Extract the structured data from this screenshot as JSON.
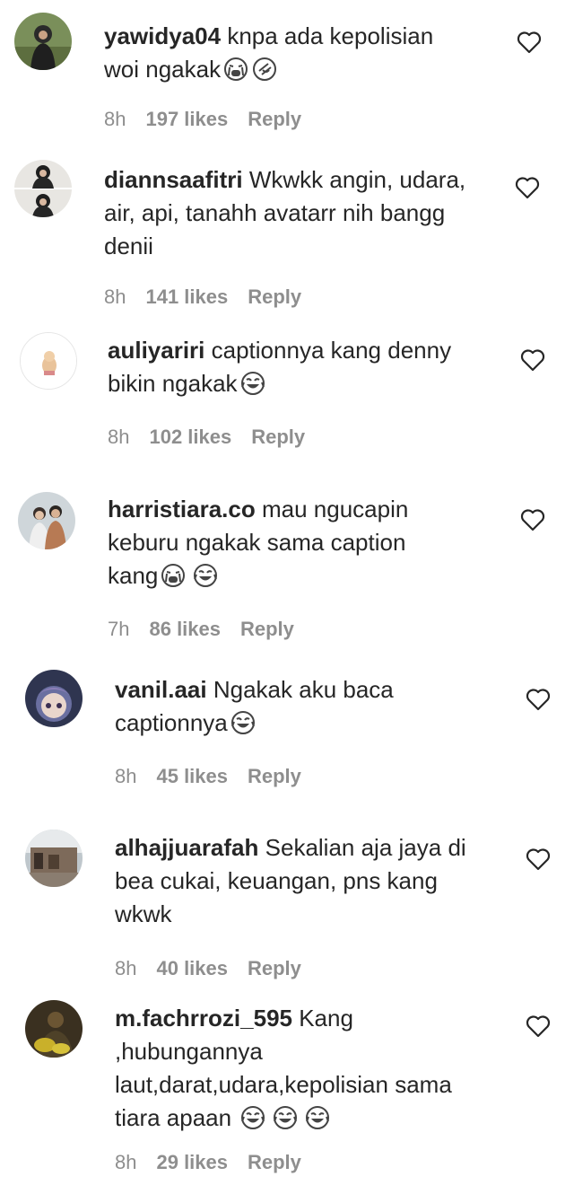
{
  "comments": [
    {
      "username": "yawidya04",
      "text_lines": [
        "knpa ada kepolisian",
        "woi ngakak"
      ],
      "emojis": [
        "loudly-crying-face-icon",
        "rolling-on-floor-laughing-icon"
      ],
      "time": "8h",
      "likes": "197 likes",
      "reply": "Reply"
    },
    {
      "username": "diannsaafitri",
      "text_lines": [
        "Wkwkk angin, udara,",
        "air, api, tanahh avatarr nih bangg",
        "denii"
      ],
      "emojis": [],
      "time": "8h",
      "likes": "141 likes",
      "reply": "Reply"
    },
    {
      "username": "auliyariri",
      "text_lines": [
        "captionnya kang denny",
        "bikin ngakak"
      ],
      "emojis": [
        "tears-of-joy-face-icon"
      ],
      "time": "8h",
      "likes": "102 likes",
      "reply": "Reply"
    },
    {
      "username": "harristiara.co",
      "text_lines": [
        "mau ngucapin",
        "keburu ngakak sama caption",
        "kang"
      ],
      "emojis": [
        "loudly-crying-face-icon",
        "tears-of-joy-face-icon"
      ],
      "time": "7h",
      "likes": "86 likes",
      "reply": "Reply"
    },
    {
      "username": "vanil.aai",
      "text_lines": [
        "Ngakak aku baca",
        "captionnya"
      ],
      "emojis": [
        "tears-of-joy-face-icon"
      ],
      "time": "8h",
      "likes": "45 likes",
      "reply": "Reply"
    },
    {
      "username": "alhajjuarafah",
      "text_lines": [
        "Sekalian aja jaya di",
        "bea cukai, keuangan, pns kang",
        "wkwk"
      ],
      "emojis": [],
      "time": "8h",
      "likes": "40 likes",
      "reply": "Reply"
    },
    {
      "username": "m.fachrrozi_595",
      "text_lines": [
        "Kang",
        ",hubungannya",
        "laut,darat,udara,kepolisian sama",
        "tiara apaan"
      ],
      "emojis": [
        "tears-of-joy-face-icon",
        "tears-of-joy-face-icon",
        "tears-of-joy-face-icon"
      ],
      "time": "8h",
      "likes": "29 likes",
      "reply": "Reply"
    }
  ],
  "colors": {
    "text": "#262626",
    "meta": "#8e8e8e",
    "emoji_stroke": "#444444"
  }
}
